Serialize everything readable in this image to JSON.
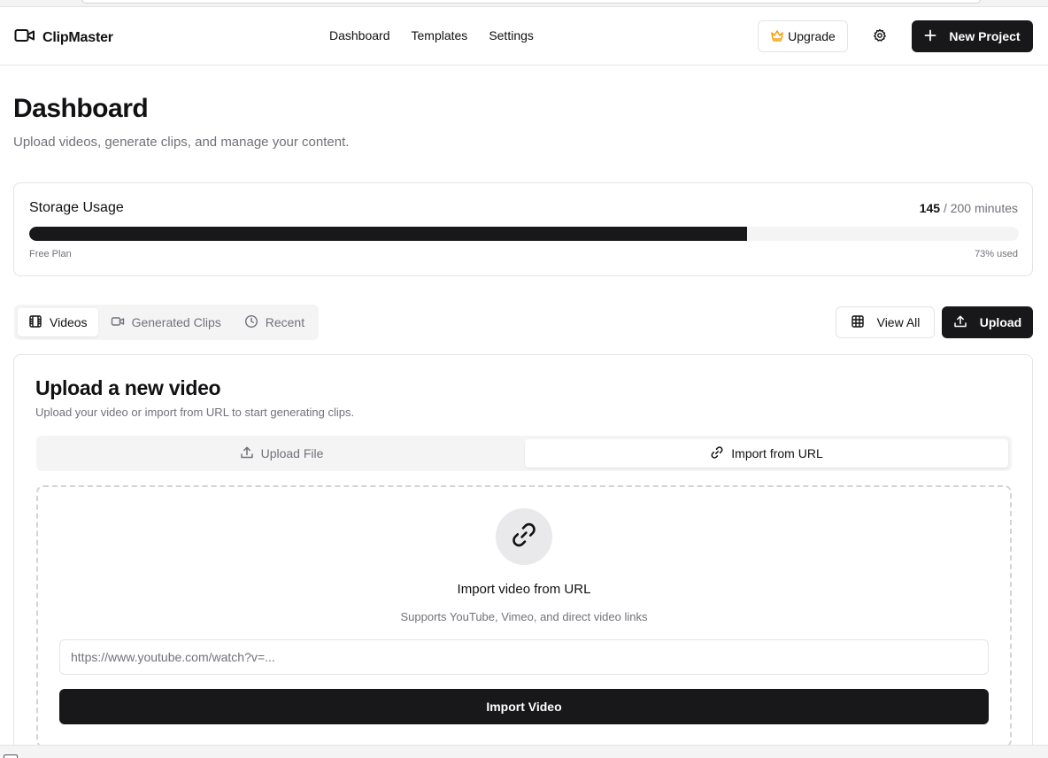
{
  "app": {
    "name": "ClipMaster"
  },
  "nav": {
    "items": [
      "Dashboard",
      "Templates",
      "Settings"
    ]
  },
  "header": {
    "upgrade_label": "Upgrade",
    "new_project_label": "New Project"
  },
  "page": {
    "title": "Dashboard",
    "subtitle": "Upload videos, generate clips, and manage your content."
  },
  "storage": {
    "title": "Storage Usage",
    "used": "145",
    "total_text": " / 200 minutes",
    "plan": "Free Plan",
    "percent_label": "73% used",
    "percent_value": 72.5
  },
  "tabs": [
    {
      "label": "Videos",
      "icon": "film-icon",
      "active": true
    },
    {
      "label": "Generated Clips",
      "icon": "video-icon",
      "active": false
    },
    {
      "label": "Recent",
      "icon": "clock-icon",
      "active": false
    }
  ],
  "actions": {
    "view_all_label": "View All",
    "upload_label": "Upload"
  },
  "upload_card": {
    "title": "Upload a new video",
    "description": "Upload your video or import from URL to start generating clips.",
    "modes": [
      {
        "label": "Upload File",
        "icon": "upload-icon",
        "active": false
      },
      {
        "label": "Import from URL",
        "icon": "link-icon",
        "active": true
      }
    ],
    "dropzone": {
      "title": "Import video from URL",
      "subtitle": "Supports YouTube, Vimeo, and direct video links",
      "url_placeholder": "https://www.youtube.com/watch?v=...",
      "url_value": "",
      "import_label": "Import Video"
    }
  },
  "colors": {
    "primary": "#18181b",
    "border": "#e4e4e7",
    "muted_text": "#71717a",
    "muted_bg": "#f4f4f5",
    "crown": "#f59e0b"
  }
}
